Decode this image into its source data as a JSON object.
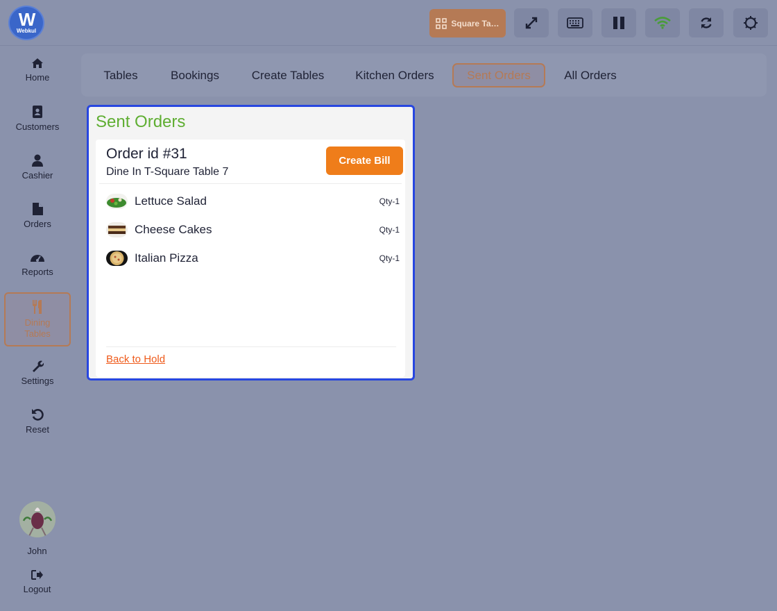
{
  "header": {
    "logo_text": "Webkul",
    "table_button_label": "Square Ta…"
  },
  "sidebar": {
    "items": [
      {
        "label": "Home"
      },
      {
        "label": "Customers"
      },
      {
        "label": "Cashier"
      },
      {
        "label": "Orders"
      },
      {
        "label": "Reports"
      },
      {
        "label": "Dining Tables"
      },
      {
        "label": "Settings"
      },
      {
        "label": "Reset"
      }
    ],
    "user_name": "John",
    "logout_label": "Logout"
  },
  "tabs": [
    {
      "label": "Tables"
    },
    {
      "label": "Bookings"
    },
    {
      "label": "Create Tables"
    },
    {
      "label": "Kitchen Orders"
    },
    {
      "label": "Sent Orders"
    },
    {
      "label": "All Orders"
    }
  ],
  "panel": {
    "title": "Sent Orders",
    "order_id": "Order id #31",
    "order_table": "Dine In T-Square Table 7",
    "create_bill_label": "Create Bill",
    "items": [
      {
        "name": "Lettuce Salad",
        "qty": "Qty-1"
      },
      {
        "name": "Cheese Cakes",
        "qty": "Qty-1"
      },
      {
        "name": "Italian Pizza",
        "qty": "Qty-1"
      }
    ],
    "back_link": "Back to Hold"
  },
  "colors": {
    "accent": "#ef7d1a",
    "title_green": "#5fae32",
    "active_tab": "#b57a55",
    "card_border": "#2746e0"
  }
}
